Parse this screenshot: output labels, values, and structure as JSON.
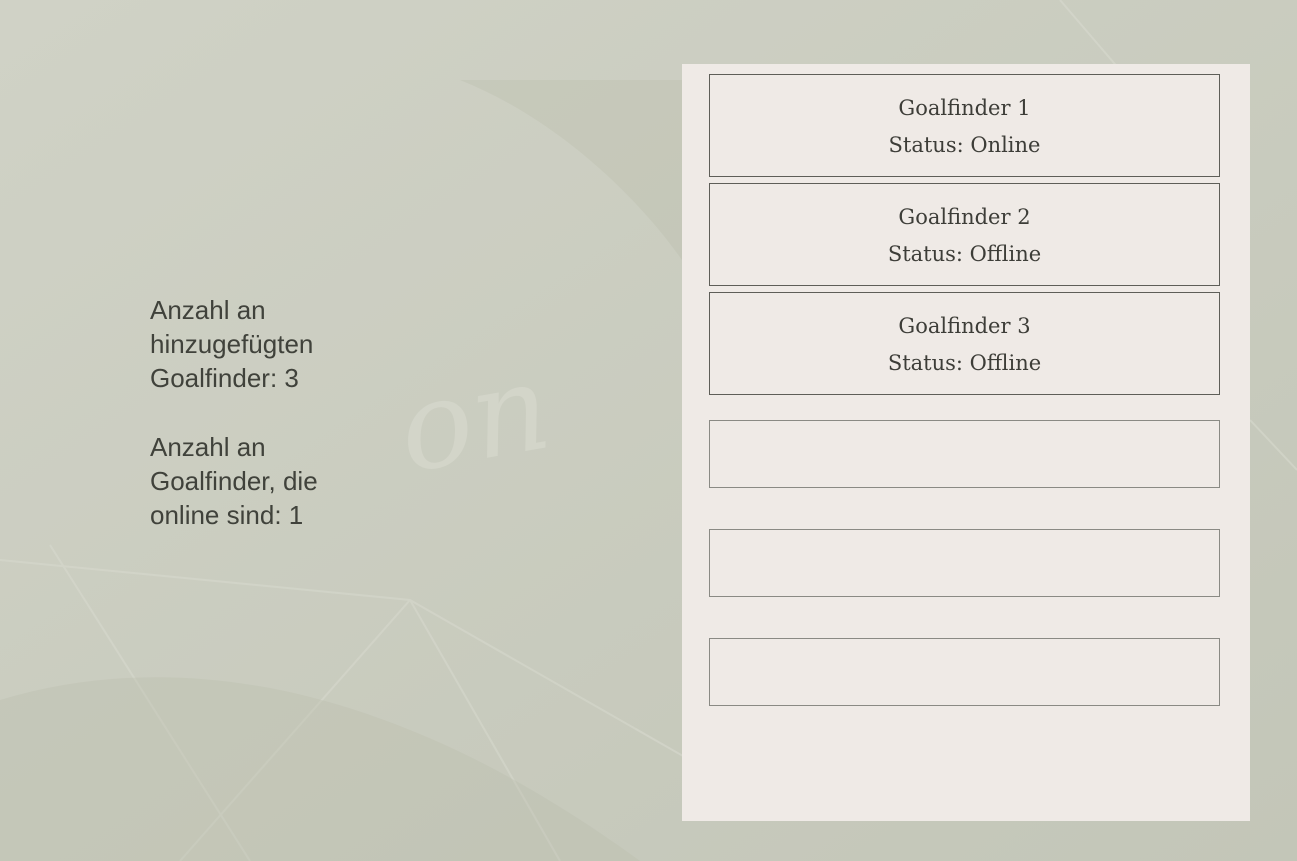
{
  "summary": {
    "added_count_text": "Anzahl an hinzugefügten Goalfinder: 3",
    "online_count_text": "Anzahl an Goalfinder, die online sind: 1"
  },
  "goalfinders": [
    {
      "name": "Goalfinder 1",
      "status": "Status: Online"
    },
    {
      "name": "Goalfinder 2",
      "status": "Status: Offline"
    },
    {
      "name": "Goalfinder 3",
      "status": "Status: Offline"
    }
  ],
  "empty_slots": 3,
  "colors": {
    "background": "#cbcdc0",
    "panel": "#efeae6",
    "text": "#40423b"
  }
}
